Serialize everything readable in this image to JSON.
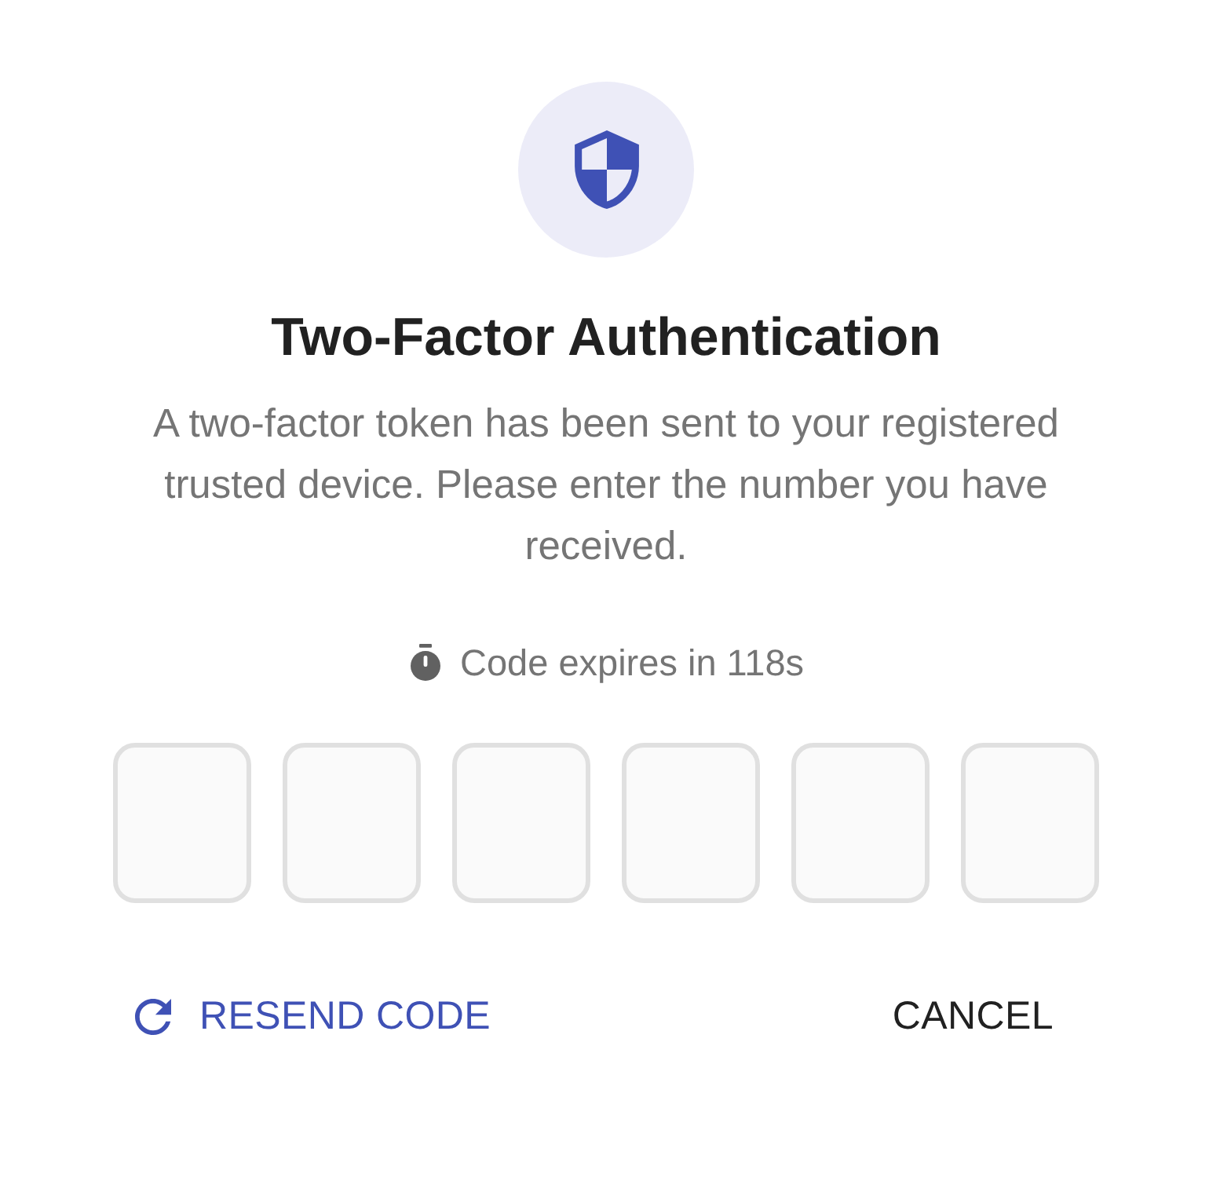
{
  "header": {
    "title": "Two-Factor Authentication",
    "description": "A two-factor token has been sent to your registered trusted device. Please enter the number you have received."
  },
  "timer": {
    "text": "Code expires in 118s"
  },
  "code_fields": [
    {
      "kind": "digit"
    },
    {
      "kind": "digit"
    },
    {
      "kind": "digit"
    },
    {
      "kind": "digit"
    },
    {
      "kind": "digit"
    },
    {
      "kind": "digit"
    }
  ],
  "actions": [
    {
      "kind": "resend",
      "label": "RESEND CODE"
    },
    {
      "kind": "cancel",
      "label": "CANCEL"
    }
  ]
}
